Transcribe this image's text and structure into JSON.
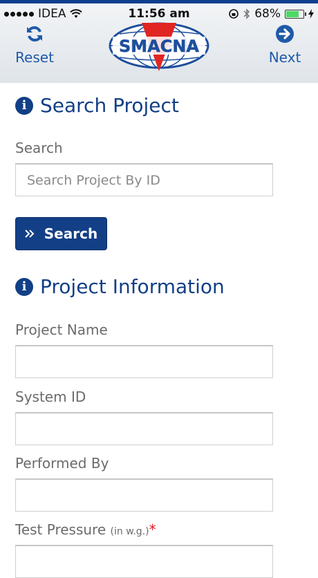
{
  "status_bar": {
    "carrier": "IDEA",
    "time": "11:56 am",
    "battery": "68%",
    "battery_level": 0.68
  },
  "header": {
    "reset_label": "Reset",
    "next_label": "Next",
    "logo_text": "SMACNA",
    "brand_color": "#1f5aa8"
  },
  "search_section": {
    "title": "Search Project",
    "search_label": "Search",
    "search_placeholder": "Search Project By ID",
    "search_button_label": "Search"
  },
  "project_section": {
    "title": "Project Information",
    "project_name_label": "Project Name",
    "system_id_label": "System ID",
    "performed_by_label": "Performed By",
    "test_pressure_label": "Test Pressure",
    "test_pressure_unit": "(in w.g.)",
    "required_mark": "*"
  }
}
